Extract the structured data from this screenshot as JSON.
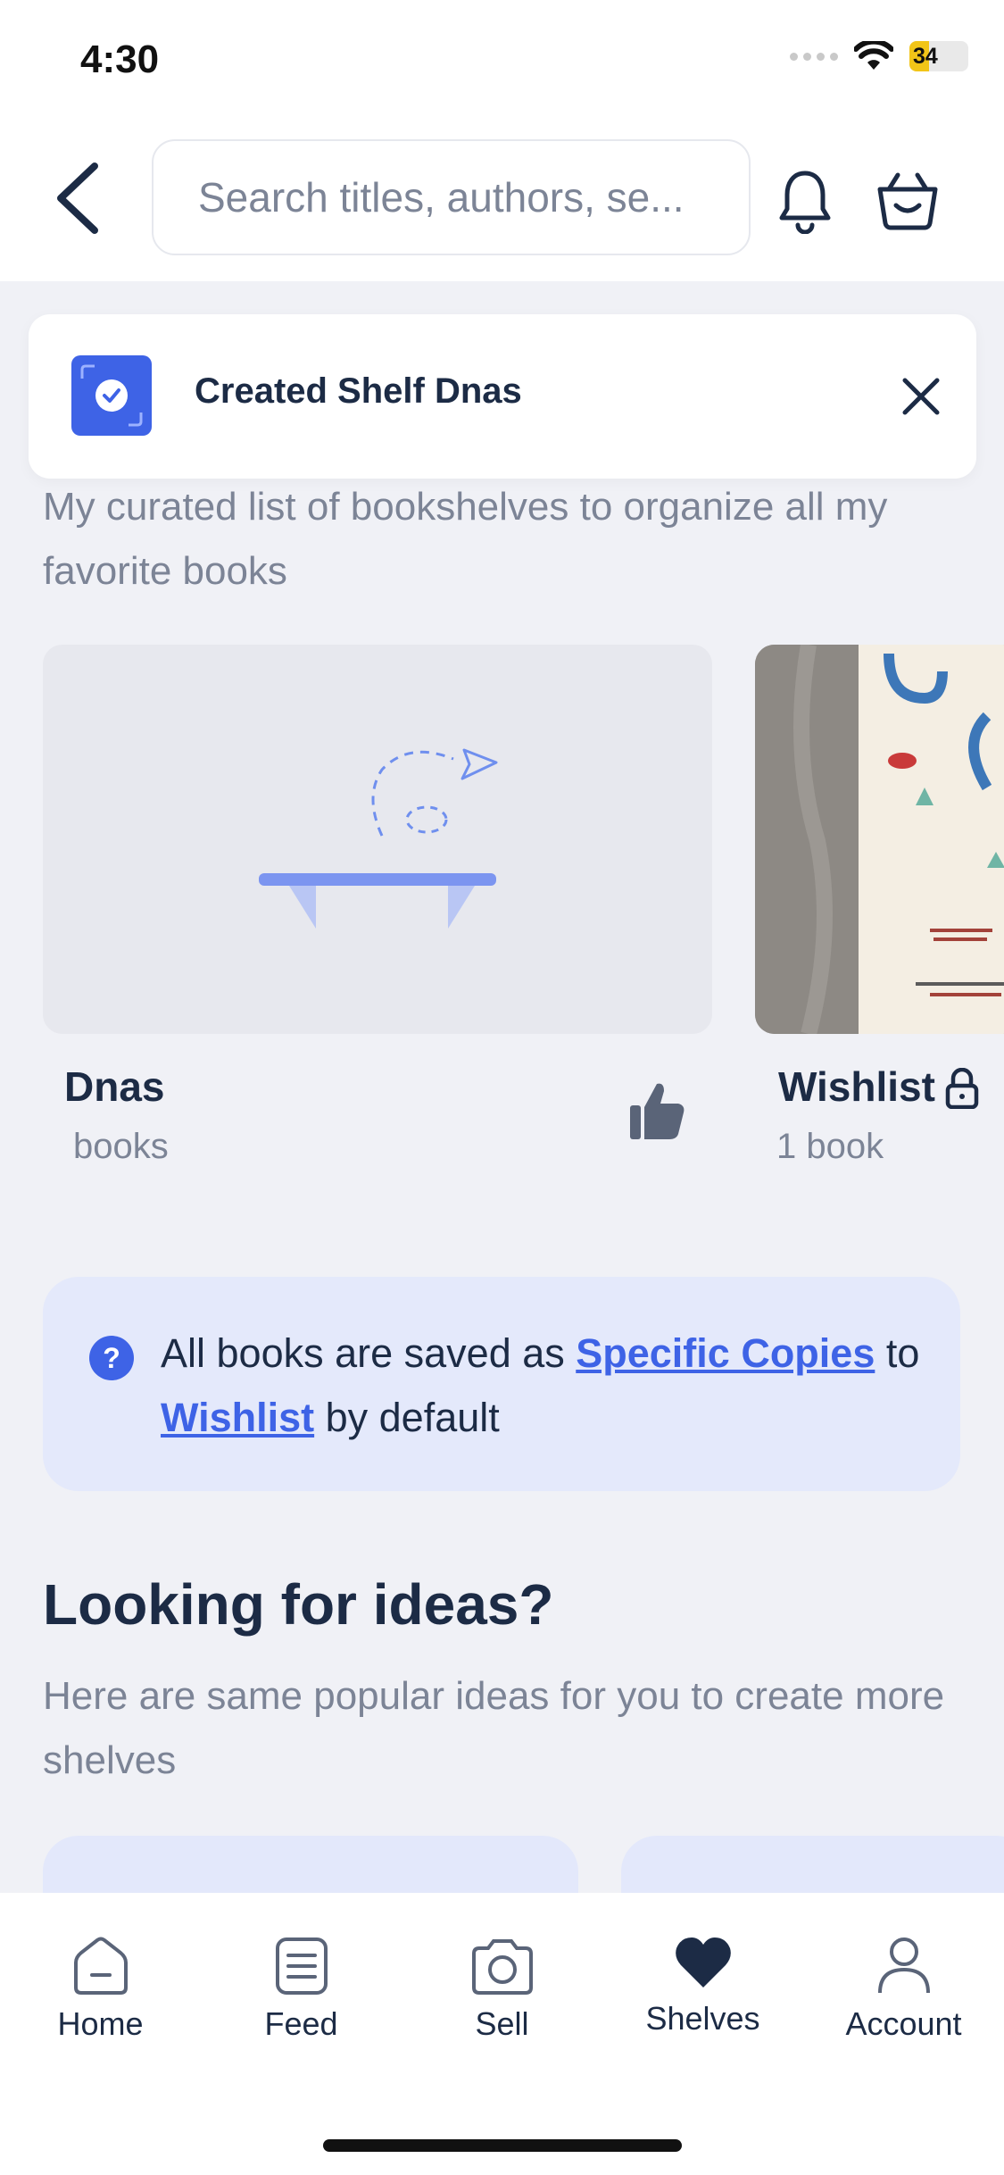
{
  "status_bar": {
    "time": "4:30",
    "battery": "34",
    "battery_level": 0.34
  },
  "header": {
    "search_placeholder": "Search titles, authors, se..."
  },
  "toast": {
    "message": "Created Shelf Dnas"
  },
  "intro": {
    "description": "My curated list of bookshelves to organize all my favorite books"
  },
  "shelves": [
    {
      "name": "Dnas",
      "count": "books"
    },
    {
      "name": "Wishlist",
      "count": "1 book"
    }
  ],
  "info": {
    "part1": "All books are saved as ",
    "link1": "Specific Copies",
    "part2": " to ",
    "link2": "Wishlist",
    "part3": " by default"
  },
  "ideas": {
    "title": "Looking for ideas?",
    "subtitle": "Here are same popular ideas for you to create more shelves"
  },
  "nav": {
    "items": [
      {
        "label": "Home",
        "icon": "home-icon"
      },
      {
        "label": "Feed",
        "icon": "feed-icon"
      },
      {
        "label": "Sell",
        "icon": "camera-icon"
      },
      {
        "label": "Shelves",
        "icon": "heart-icon"
      },
      {
        "label": "Account",
        "icon": "account-icon"
      }
    ]
  },
  "colors": {
    "accent": "#3e63e6",
    "text_dark": "#1c2b45",
    "text_muted": "#7c8496",
    "background": "#f0f1f6"
  }
}
